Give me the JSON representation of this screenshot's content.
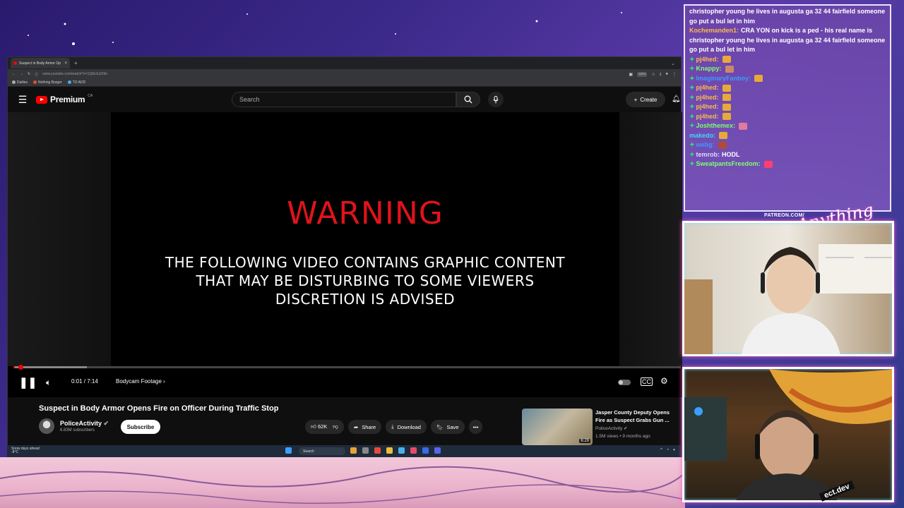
{
  "browser": {
    "tab_title": "Suspect in Body Armor Op",
    "url": "www.youtube.com/watch?v=1Q8z3u029e",
    "zoom": "150%",
    "bookmarks": [
      "Dailies",
      "Nothing Burger",
      "TO ADD"
    ]
  },
  "youtube": {
    "brand": "Premium",
    "region": "CA",
    "search_placeholder": "Search",
    "create_label": "Create"
  },
  "player": {
    "warning_title": "WARNING",
    "warning_lines": [
      "THE FOLLOWING VIDEO CONTAINS GRAPHIC CONTENT",
      "THAT MAY BE DISTURBING TO SOME VIEWERS",
      "DISCRETION IS ADVISED"
    ],
    "time": "0:01 / 7:14",
    "chapter": "Bodycam Footage",
    "played_fraction": 0.002,
    "buffered_fraction": 0.11
  },
  "video": {
    "title": "Suspect in Body Armor Opens Fire on Officer During Traffic Stop",
    "channel": "PoliceActivity",
    "subscribers": "6.83M subscribers",
    "subscribe_label": "Subscribe",
    "likes": "62K",
    "share_label": "Share",
    "download_label": "Download",
    "save_label": "Save"
  },
  "recommendation": {
    "title": "Jasper County Deputy Opens Fire as Suspect Grabs Gun ...",
    "channel": "PoliceActivity",
    "meta": "1.5M views • 9 months ago",
    "duration": "6:29"
  },
  "taskbar": {
    "weather_line1": "Snow days ahead",
    "weather_line2": "-8°C",
    "search_label": "Search"
  },
  "chat": [
    {
      "user": "",
      "text": "christopher young he lives in augusta ga 32 44 fairfield someone go put a bul let in him",
      "color": "#ffffff",
      "badge": false
    },
    {
      "user": "Kochemanden1:",
      "text": "CRA YON on kick is a ped - his real name is christopher young he lives in augusta ga 32 44 fairfield someone go put a bul let in him",
      "color": "#ffb84d",
      "badge": false
    },
    {
      "user": "pj4hed:",
      "text": "",
      "color": "#ffb84d",
      "badge": true,
      "emote": "#e8a93a"
    },
    {
      "user": "Knappy:",
      "text": "",
      "color": "#7dff6b",
      "badge": true,
      "emote": "#c98a6a"
    },
    {
      "user": "ImaginaryFanboy:",
      "text": "",
      "color": "#3d9bff",
      "badge": true,
      "emote": "#e8a93a"
    },
    {
      "user": "pj4hed:",
      "text": "",
      "color": "#ffb84d",
      "badge": true,
      "emote": "#e8a93a"
    },
    {
      "user": "pj4hed:",
      "text": "",
      "color": "#ffb84d",
      "badge": true,
      "emote": "#e8a93a"
    },
    {
      "user": "pj4hed:",
      "text": "",
      "color": "#ffb84d",
      "badge": true,
      "emote": "#e8a93a"
    },
    {
      "user": "pj4hed:",
      "text": "",
      "color": "#ffb84d",
      "badge": true,
      "emote": "#e8a93a"
    },
    {
      "user": "Joshthemex:",
      "text": "",
      "color": "#7dff6b",
      "badge": true,
      "emote": "#e27aa0"
    },
    {
      "user": "makedo:",
      "text": "",
      "color": "#3dd6ff",
      "badge": false,
      "emote": "#e8a93a"
    },
    {
      "user": "webg:",
      "text": "",
      "color": "#3d9bff",
      "badge": true,
      "emote": "#b04a3a"
    },
    {
      "user": "temrob:",
      "text": "HODL",
      "color": "#d9d9ff",
      "badge": true
    },
    {
      "user": "SweatpantsFreedom:",
      "text": "",
      "color": "#7dff6b",
      "badge": true,
      "emote": "#ff3f6c"
    }
  ],
  "overlay": {
    "patreon": "PATREON.COM/",
    "signature": "Anything Else?",
    "sticker": "ect.dev"
  },
  "colors": {
    "youtube_red": "#ff0000",
    "warning_red": "#e0131a"
  }
}
